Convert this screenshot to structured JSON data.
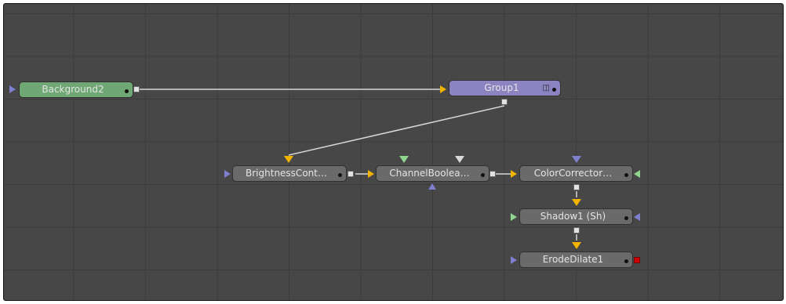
{
  "colors": {
    "canvas": "#474747",
    "grid": "#3c3c3c",
    "wire": "#d7d7d7",
    "node_tool": "#6a6a6a",
    "node_background": "#6fa874",
    "node_group": "#8c84c0",
    "input_yellow": "#f2b400",
    "input_green": "#8fd48f",
    "input_white": "#d8d8d8",
    "mask_blue": "#7f7fd0",
    "output_square": "#e2e2e2",
    "output_red": "#d00000"
  },
  "nodes": {
    "background2": {
      "label": "Background2",
      "type": "generator",
      "color": "#6fa874"
    },
    "group1": {
      "label": "Group1",
      "type": "group",
      "color": "#8c84c0",
      "icon": "group-expand-icon"
    },
    "brightness": {
      "label": "BrightnessCont…",
      "type": "tool",
      "color": "#6a6a6a"
    },
    "channel": {
      "label": "ChannelBoolea…",
      "type": "tool",
      "color": "#6a6a6a"
    },
    "colorcorrector": {
      "label": "ColorCorrector…",
      "type": "tool",
      "color": "#6a6a6a"
    },
    "shadow": {
      "label": "Shadow1 (Sh)",
      "type": "tool",
      "color": "#6a6a6a"
    },
    "erode": {
      "label": "ErodeDilate1",
      "type": "tool",
      "color": "#6a6a6a",
      "output_state": "red"
    }
  },
  "connections": [
    {
      "from": "Background2",
      "to": "Group1"
    },
    {
      "from": "Group1",
      "to": "BrightnessCont…"
    },
    {
      "from": "BrightnessCont…",
      "to": "ChannelBoolea…"
    },
    {
      "from": "ChannelBoolea…",
      "to": "ColorCorrector…"
    },
    {
      "from": "ColorCorrector…",
      "to": "Shadow1 (Sh)"
    },
    {
      "from": "Shadow1 (Sh)",
      "to": "ErodeDilate1"
    }
  ]
}
